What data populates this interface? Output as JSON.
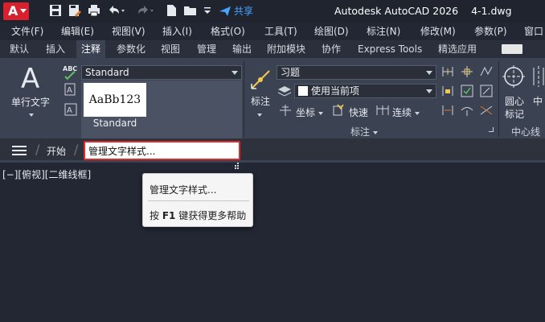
{
  "app": {
    "logo_letter": "A",
    "share_label": "共享",
    "title": "Autodesk AutoCAD 2026",
    "filename": "4-1.dwg"
  },
  "menu": {
    "items": [
      "文件(F)",
      "编辑(E)",
      "视图(V)",
      "插入(I)",
      "格式(O)",
      "工具(T)",
      "绘图(D)",
      "标注(N)",
      "修改(M)",
      "参数(P)",
      "窗口"
    ]
  },
  "ribbon_tabs": {
    "items": [
      "默认",
      "插入",
      "注释",
      "参数化",
      "视图",
      "管理",
      "输出",
      "附加模块",
      "协作",
      "Express Tools",
      "精选应用"
    ],
    "active": "注释"
  },
  "ribbon": {
    "text_panel": {
      "single_line_text_label": "单行文字",
      "text_style_value": "Standard",
      "style_preview_sample": "AaBb123",
      "style_preview_name": "Standard",
      "abc_label": "ABC"
    },
    "dimension_panel": {
      "dim_button_label": "标注",
      "dim_style_value": "习题",
      "layer_value": "使用当前项",
      "coord_label": "坐标",
      "quick_label": "快速",
      "continue_label": "连续",
      "panel_title": "标注"
    },
    "centerline_panel": {
      "center_mark_label_line1": "圆心",
      "center_mark_label_line2": "标记",
      "centerline_label_partial": "中",
      "panel_title": "中心线"
    }
  },
  "command_bar": {
    "start_tab": "开始",
    "search_value": "管理文字样式..."
  },
  "viewport": {
    "label": "[−][俯视][二维线框]"
  },
  "suggestions": {
    "item1": "管理文字样式...",
    "item2_prefix": "按",
    "item2_key": "F1",
    "item2_suffix": "键获得更多帮助"
  },
  "colors": {
    "accent_red": "#e02a2a",
    "share_blue": "#4aa3ff",
    "logo_red": "#d8202e"
  }
}
